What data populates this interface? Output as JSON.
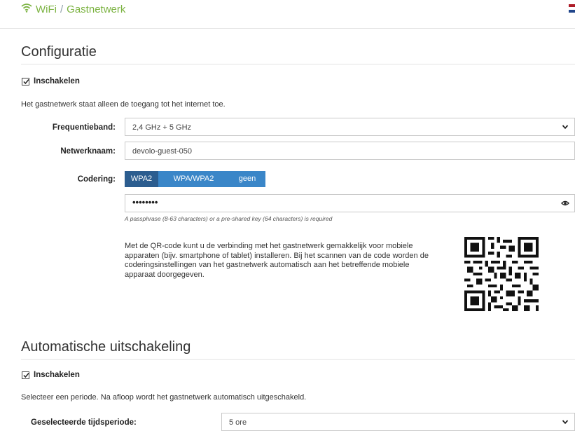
{
  "header": {
    "wifi_label": "WiFi",
    "separator": "/",
    "page_label": "Gastnetwerk",
    "accent_color": "#7cb342"
  },
  "config": {
    "title": "Configuratie",
    "enable_label": "Inschakelen",
    "enabled": true,
    "description": "Het gastnetwerk staat alleen de toegang tot het internet toe.",
    "freq_label": "Frequentieband:",
    "freq_value": "2,4 GHz + 5 GHz",
    "ssid_label": "Netwerknaam:",
    "ssid_value": "devolo-guest-050",
    "enc_label": "Codering:",
    "enc_options": [
      "WPA2",
      "WPA/WPA2",
      "geen"
    ],
    "enc_selected": "WPA2",
    "password_mask": "••••••••",
    "password_hint": "A passphrase (8-63 characters) or a pre-shared key (64 characters) is required",
    "qr_text": "Met de QR-code kunt u de verbinding met het gastnetwerk gemakkelijk voor mobiele apparaten (bijv. smartphone of tablet) installeren. Bij het scannen van de code worden de coderingsinstellingen van het gastnetwerk automatisch aan het betreffende mobiele apparaat doorgegeven."
  },
  "auto_off": {
    "title": "Automatische uitschakeling",
    "enable_label": "Inschakelen",
    "enabled": true,
    "description": "Selecteer een periode. Na afloop wordt het gastnetwerk automatisch uitgeschakeld.",
    "period_label": "Geselecteerde tijdsperiode:",
    "period_value": "5 ore"
  },
  "icons": {
    "wifi": "wifi-icon",
    "flag": "flag-icon",
    "chevron": "chevron-down-icon",
    "eye": "eye-icon",
    "qr": "qr-code"
  },
  "colors": {
    "segment_active": "#2c5d8f",
    "segment_inactive": "#3a86c8",
    "section_rule": "#e3e3e3"
  }
}
